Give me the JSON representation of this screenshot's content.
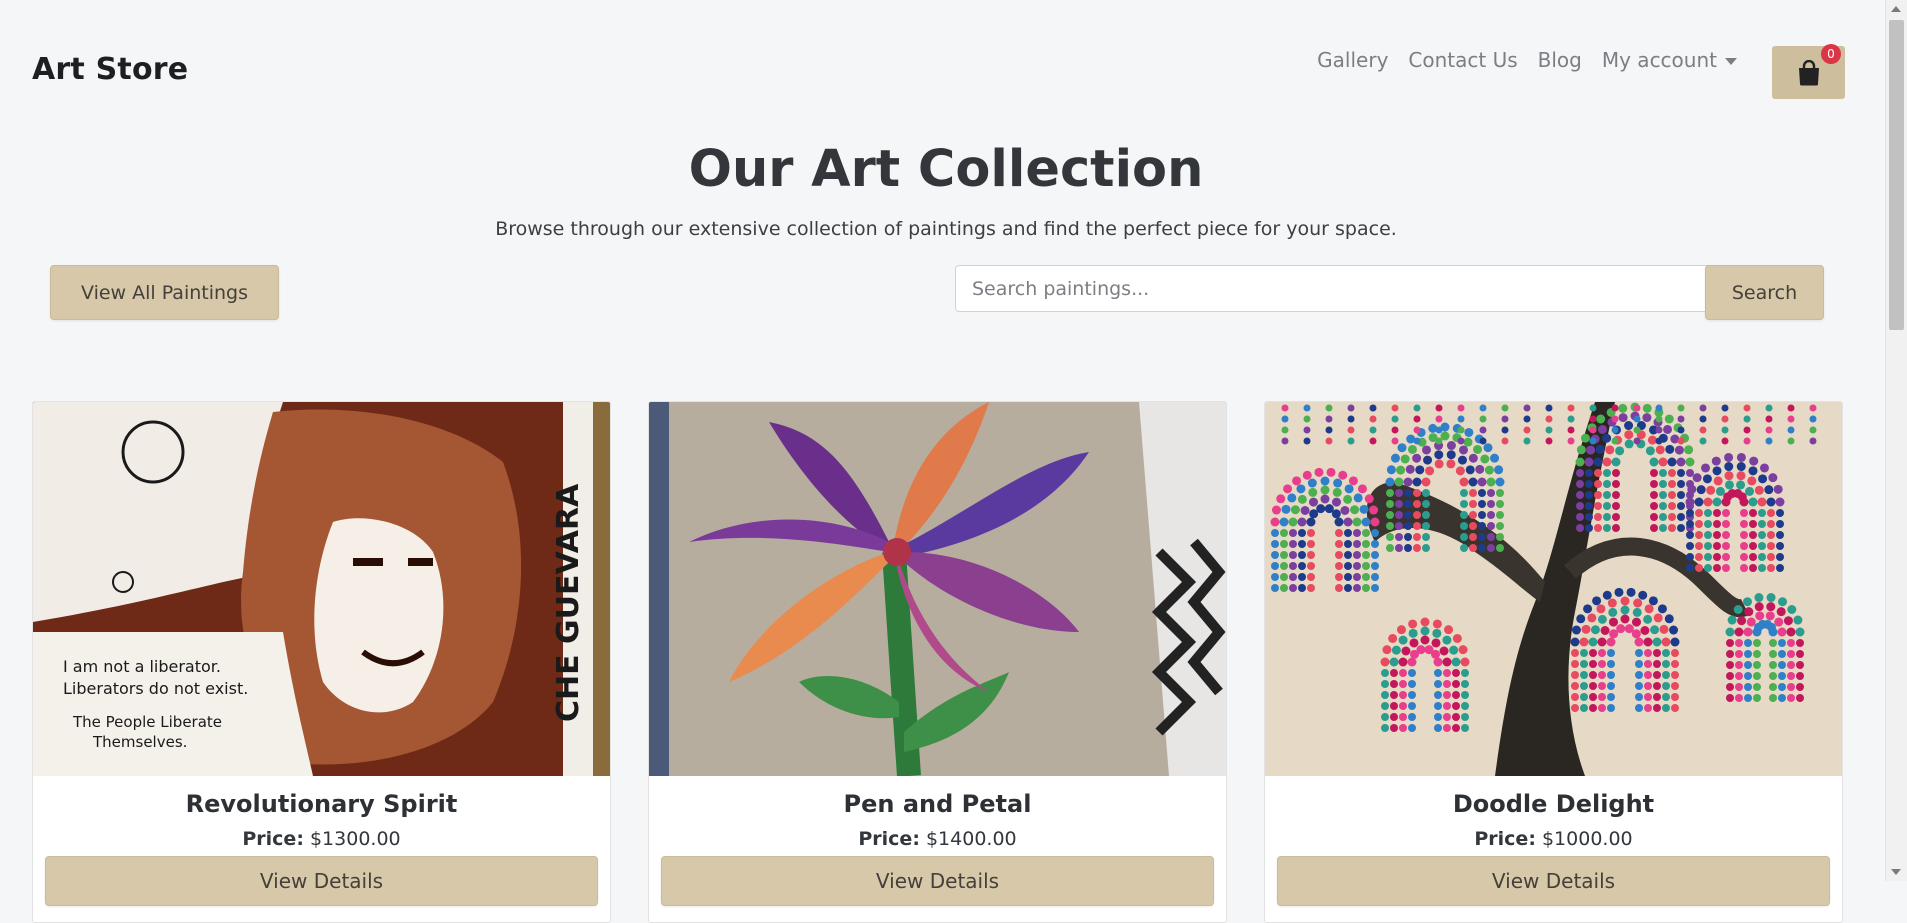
{
  "header": {
    "brand": "Art Store",
    "nav": [
      "Gallery",
      "Contact Us",
      "Blog",
      "My account"
    ],
    "cart_count": "0",
    "cart_icon": "shopping-bag-icon"
  },
  "hero": {
    "title": "Our Art Collection",
    "subtitle": "Browse through our extensive collection of paintings and find the perfect piece for your space.",
    "view_all_label": "View All Paintings",
    "search_placeholder": "Search paintings...",
    "search_value": "",
    "search_button": "Search"
  },
  "paintings": [
    {
      "name": "Revolutionary Spirit",
      "price_label": "Price:",
      "price": "$1300.00",
      "button": "View Details",
      "image": "che-guevara-ink-portrait"
    },
    {
      "name": "Pen and Petal",
      "price_label": "Price:",
      "price": "$1400.00",
      "button": "View Details",
      "image": "colored-pen-flower"
    },
    {
      "name": "Doodle Delight",
      "price_label": "Price:",
      "price": "$1000.00",
      "button": "View Details",
      "image": "dotted-willow-tree"
    }
  ],
  "colors": {
    "accent": "#d6c8a8",
    "badge": "#dc3545",
    "background": "#f5f6f7"
  }
}
